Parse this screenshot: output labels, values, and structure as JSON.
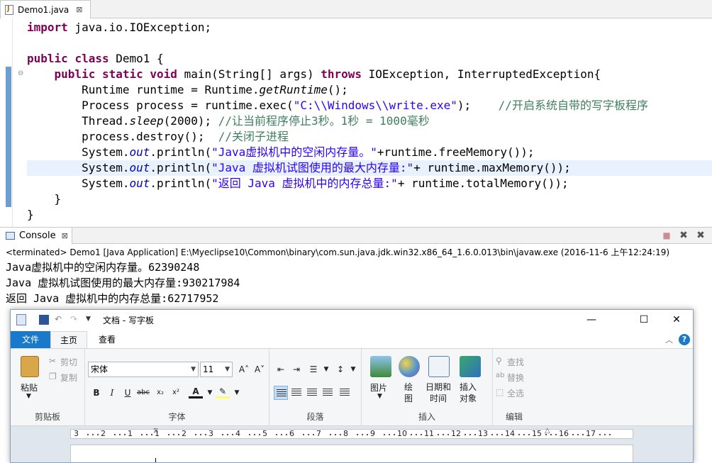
{
  "editor": {
    "tab_title": "Demo1.java",
    "tab_close": "⊠",
    "lines": {
      "l1_kw": "import",
      "l1_rest": " java.io.IOException;",
      "l3_kw1": "public",
      "l3_kw2": "class",
      "l3_rest": " Demo1 {",
      "l4_kw1": "public",
      "l4_kw2": "static",
      "l4_kw3": "void",
      "l4_mid": " main(String[] args) ",
      "l4_kw4": "throws",
      "l4_rest": " IOException, InterruptedException{",
      "l5_a": "Runtime runtime = Runtime.",
      "l5_it": "getRuntime",
      "l5_b": "();",
      "l6_a": "Process process = runtime.exec(",
      "l6_str": "\"C:\\\\Windows\\\\write.exe\"",
      "l6_b": ");    ",
      "l6_cmt": "//开启系统自带的写字板程序",
      "l7_a": "Thread.",
      "l7_it": "sleep",
      "l7_b": "(2000); ",
      "l7_cmt": "//让当前程序停止3秒。1秒 = 1000毫秒",
      "l8_a": "process.destroy();  ",
      "l8_cmt": "//关闭子进程",
      "l9_a": "System.",
      "l9_fld": "out",
      "l9_b": ".println(",
      "l9_str": "\"Java虚拟机中的空闲内存量。\"",
      "l9_c": "+runtime.freeMemory());",
      "l10_a": "System.",
      "l10_fld": "out",
      "l10_b": ".println(",
      "l10_str": "\"Java 虚拟机试图使用的最大内存量:\"",
      "l10_c": "+ runtime.maxMemory());",
      "l11_a": "System.",
      "l11_fld": "out",
      "l11_b": ".println(",
      "l11_str": "\"返回 Java 虚拟机中的内存总量:\"",
      "l11_c": "+ runtime.totalMemory());",
      "l12": "}",
      "l13": "}"
    }
  },
  "console": {
    "tab_title": "Console",
    "tab_close": "⊠",
    "terminated": "<terminated> Demo1 [Java Application] E:\\Myeclipse10\\Common\\binary\\com.sun.java.jdk.win32.x86_64_1.6.0.013\\bin\\javaw.exe (2016-11-6 上午12:24:19)",
    "output": [
      "Java虚拟机中的空闲内存量。62390248",
      "Java 虚拟机试图使用的最大内存量:930217984",
      "返回 Java 虚拟机中的内存总量:62717952"
    ]
  },
  "wordpad": {
    "title": "文档 - 写字板",
    "tabs": {
      "file": "文件",
      "home": "主页",
      "view": "查看"
    },
    "clipboard": {
      "paste": "粘贴",
      "cut": "剪切",
      "copy": "复制",
      "label": "剪贴板"
    },
    "font": {
      "name": "宋体",
      "size": "11",
      "label": "字体"
    },
    "paragraph": {
      "label": "段落"
    },
    "insert": {
      "picture": "图片",
      "paint": "绘图",
      "datetime": "日期和时间",
      "object": "插入对象",
      "label": "插入"
    },
    "editing": {
      "find": "查找",
      "replace": "替换",
      "select_all": "全选",
      "label": "编辑"
    },
    "ruler_numbers": [
      "3",
      "2",
      "1",
      "1",
      "2",
      "3",
      "4",
      "5",
      "6",
      "7",
      "8",
      "9",
      "10",
      "11",
      "12",
      "13",
      "14",
      "15",
      "16",
      "17"
    ],
    "colors": {
      "file_tab": "#1979ca"
    }
  }
}
